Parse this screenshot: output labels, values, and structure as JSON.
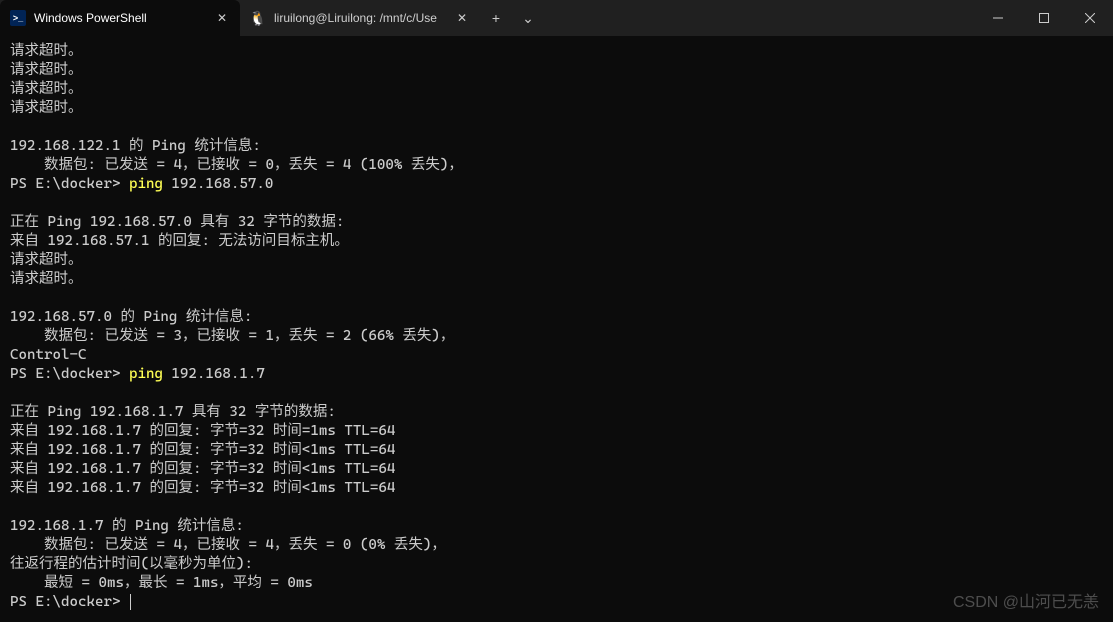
{
  "titlebar": {
    "tabs": [
      {
        "label": "Windows PowerShell",
        "icon": "powershell",
        "active": true
      },
      {
        "label": "liruilong@Liruilong: /mnt/c/Use",
        "icon": "tux",
        "active": false
      }
    ],
    "new_tab_glyph": "+",
    "dropdown_glyph": "⌄",
    "minimize_glyph": "—",
    "maximize_glyph": "▢",
    "close_glyph": "✕"
  },
  "terminal": {
    "lines": [
      {
        "type": "text",
        "text": "请求超时。"
      },
      {
        "type": "text",
        "text": "请求超时。"
      },
      {
        "type": "text",
        "text": "请求超时。"
      },
      {
        "type": "text",
        "text": "请求超时。"
      },
      {
        "type": "blank"
      },
      {
        "type": "text",
        "text": "192.168.122.1 的 Ping 统计信息:"
      },
      {
        "type": "text",
        "text": "    数据包: 已发送 = 4，已接收 = 0，丢失 = 4 (100% 丢失)，"
      },
      {
        "type": "prompt",
        "prompt": "PS E:\\docker> ",
        "cmd": "ping",
        "args": " 192.168.57.0"
      },
      {
        "type": "blank"
      },
      {
        "type": "text",
        "text": "正在 Ping 192.168.57.0 具有 32 字节的数据:"
      },
      {
        "type": "text",
        "text": "来自 192.168.57.1 的回复: 无法访问目标主机。"
      },
      {
        "type": "text",
        "text": "请求超时。"
      },
      {
        "type": "text",
        "text": "请求超时。"
      },
      {
        "type": "blank"
      },
      {
        "type": "text",
        "text": "192.168.57.0 的 Ping 统计信息:"
      },
      {
        "type": "text",
        "text": "    数据包: 已发送 = 3，已接收 = 1，丢失 = 2 (66% 丢失)，"
      },
      {
        "type": "text",
        "text": "Control-C"
      },
      {
        "type": "prompt",
        "prompt": "PS E:\\docker> ",
        "cmd": "ping",
        "args": " 192.168.1.7"
      },
      {
        "type": "blank"
      },
      {
        "type": "text",
        "text": "正在 Ping 192.168.1.7 具有 32 字节的数据:"
      },
      {
        "type": "text",
        "text": "来自 192.168.1.7 的回复: 字节=32 时间=1ms TTL=64"
      },
      {
        "type": "text",
        "text": "来自 192.168.1.7 的回复: 字节=32 时间<1ms TTL=64"
      },
      {
        "type": "text",
        "text": "来自 192.168.1.7 的回复: 字节=32 时间<1ms TTL=64"
      },
      {
        "type": "text",
        "text": "来自 192.168.1.7 的回复: 字节=32 时间<1ms TTL=64"
      },
      {
        "type": "blank"
      },
      {
        "type": "text",
        "text": "192.168.1.7 的 Ping 统计信息:"
      },
      {
        "type": "text",
        "text": "    数据包: 已发送 = 4，已接收 = 4，丢失 = 0 (0% 丢失)，"
      },
      {
        "type": "text",
        "text": "往返行程的估计时间(以毫秒为单位):"
      },
      {
        "type": "text",
        "text": "    最短 = 0ms，最长 = 1ms，平均 = 0ms"
      },
      {
        "type": "prompt_cursor",
        "prompt": "PS E:\\docker> "
      }
    ]
  },
  "watermark": "CSDN @山河已无恙"
}
